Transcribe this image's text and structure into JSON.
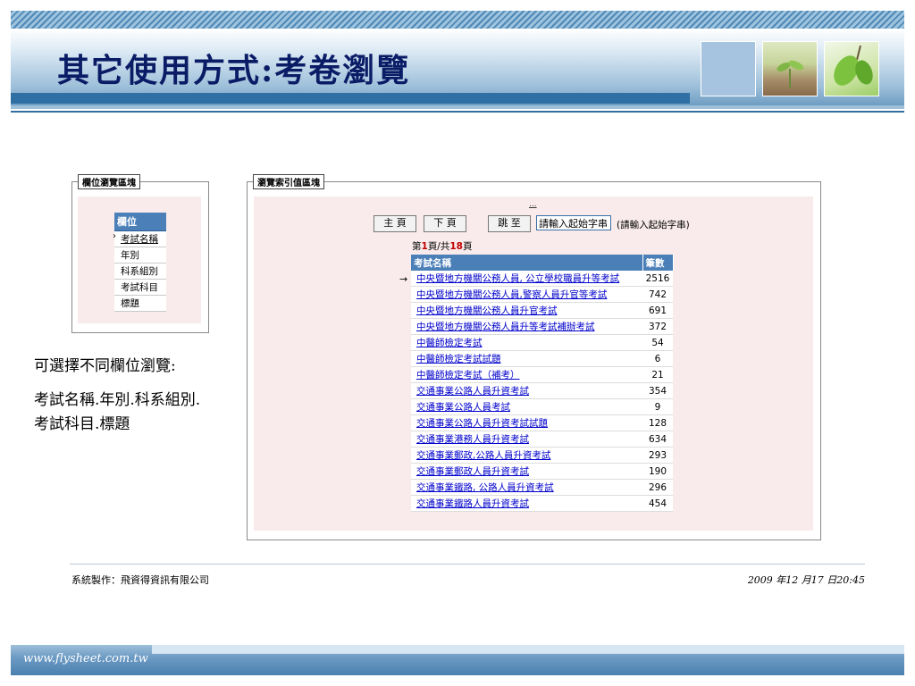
{
  "slide": {
    "title": "其它使用方式:考卷瀏覽",
    "description_lines": [
      "可選擇不同欄位瀏覽:",
      "考試名稱.年別.科系組別.",
      "考試科目.標題"
    ],
    "footer_left": "系統製作：飛資得資訊有限公司",
    "footer_right": "2009 年12 月17 日20:45",
    "website": "www.flysheet.com.tw"
  },
  "field_panel": {
    "label": "欄位瀏覽區塊",
    "header": "欄位",
    "items": [
      "考試名稱",
      "年別",
      "科系組別",
      "考試科目",
      "標題"
    ],
    "selected_index": 0,
    "caret": "›"
  },
  "browse_panel": {
    "label": "瀏覽索引值區塊",
    "dots": "...",
    "buttons": {
      "home": "主 頁",
      "next": "下 頁",
      "jump": "跳 至"
    },
    "input_value": "請輸入起始字串",
    "input_hint": "(請輸入起始字串)",
    "page_info": {
      "prefix": "第",
      "current": "1",
      "middle": "頁/共",
      "total": "18",
      "suffix": "頁"
    },
    "row_arrow": "→",
    "table": {
      "columns": [
        "考試名稱",
        "筆數"
      ],
      "rows": [
        {
          "name": "中央暨地方機關公務人員, 公立學校職員升等考試",
          "count": "2516"
        },
        {
          "name": "中央暨地方機關公務人員,警察人員升官等考試",
          "count": "742"
        },
        {
          "name": "中央暨地方機關公務人員升官考試",
          "count": "691"
        },
        {
          "name": "中央暨地方機關公務人員升等考試補辦考試",
          "count": "372"
        },
        {
          "name": "中醫師檢定考試",
          "count": "54"
        },
        {
          "name": "中醫師檢定考試試題",
          "count": "6"
        },
        {
          "name": "中醫師檢定考試（補考）",
          "count": "21"
        },
        {
          "name": "交通事業公路人員升資考試",
          "count": "354"
        },
        {
          "name": "交通事業公路人員考試",
          "count": "9"
        },
        {
          "name": "交通事業公路人員升資考試試題",
          "count": "128"
        },
        {
          "name": "交通事業港務人員升資考試",
          "count": "634"
        },
        {
          "name": "交通事業郵政,公路人員升資考試",
          "count": "293"
        },
        {
          "name": "交通事業郵政人員升資考試",
          "count": "190"
        },
        {
          "name": "交通事業鐵路, 公路人員升資考試",
          "count": "296"
        },
        {
          "name": "交通事業鐵路人員升資考試",
          "count": "454"
        }
      ]
    }
  },
  "colors": {
    "title": "#0b1c66",
    "header_blue": "#4b7fb8",
    "link": "#0000cc",
    "pane_pink": "#f9ebeb"
  }
}
